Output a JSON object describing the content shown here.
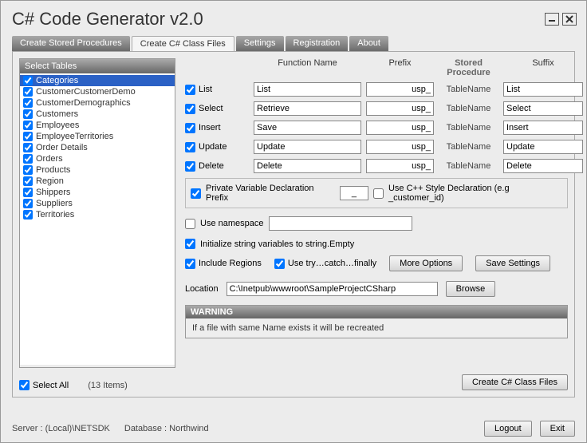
{
  "window": {
    "title": "C# Code Generator v2.0"
  },
  "tabs": {
    "stored": "Create Stored Procedures",
    "csharp": "Create C# Class Files",
    "settings": "Settings",
    "registration": "Registration",
    "about": "About"
  },
  "tablesPanel": {
    "header": "Select Tables",
    "items": [
      "Categories",
      "CustomerCustomerDemo",
      "CustomerDemographics",
      "Customers",
      "Employees",
      "EmployeeTerritories",
      "Order Details",
      "Orders",
      "Products",
      "Region",
      "Shippers",
      "Suppliers",
      "Territories"
    ],
    "selectAll": "Select All",
    "count": "(13 Items)"
  },
  "columns": {
    "func": "Function Name",
    "prefix": "Prefix",
    "sp": "Stored Procedure",
    "suffix": "Suffix"
  },
  "rows": [
    {
      "label": "List",
      "func": "List",
      "prefix": "usp_",
      "mid": "TableName",
      "suffix": "List"
    },
    {
      "label": "Select",
      "func": "Retrieve",
      "prefix": "usp_",
      "mid": "TableName",
      "suffix": "Select"
    },
    {
      "label": "Insert",
      "func": "Save",
      "prefix": "usp_",
      "mid": "TableName",
      "suffix": "Insert"
    },
    {
      "label": "Update",
      "func": "Update",
      "prefix": "usp_",
      "mid": "TableName",
      "suffix": "Update"
    },
    {
      "label": "Delete",
      "func": "Delete",
      "prefix": "usp_",
      "mid": "TableName",
      "suffix": "Delete"
    }
  ],
  "pv": {
    "label": "Private Variable Declaration Prefix",
    "value": "_",
    "cpp": "Use C++ Style Declaration (e.g _customer_id)"
  },
  "ns": {
    "label": "Use namespace",
    "value": ""
  },
  "opts": {
    "init": "Initialize string variables to string.Empty",
    "regions": "Include Regions",
    "trycatch": "Use try…catch…finally",
    "more": "More Options",
    "save": "Save Settings"
  },
  "loc": {
    "label": "Location",
    "value": "C:\\Inetpub\\wwwroot\\SampleProjectCSharp",
    "browse": "Browse"
  },
  "warn": {
    "title": "WARNING",
    "text": "If a file with same Name exists it will be recreated"
  },
  "create": "Create C# Class Files",
  "status": {
    "server": "Server :  (Local)\\NETSDK",
    "db": "Database :  Northwind",
    "logout": "Logout",
    "exit": "Exit"
  }
}
